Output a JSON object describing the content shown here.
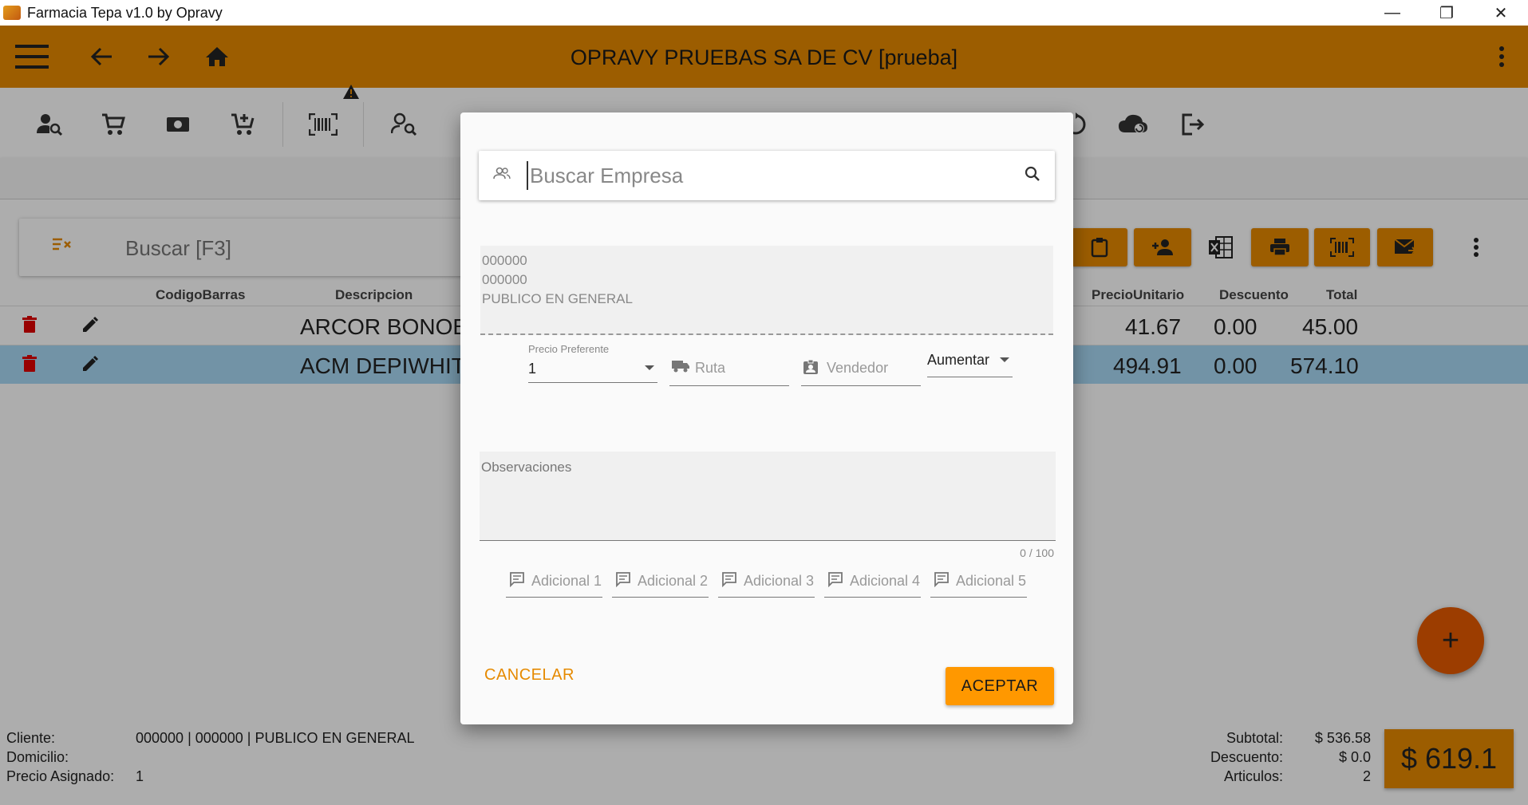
{
  "window": {
    "title": "Farmacia Tepa v1.0 by Opravy",
    "minimize": "—",
    "restore": "❐",
    "close": "✕"
  },
  "appbar": {
    "company": "OPRAVY PRUEBAS SA DE CV [prueba]",
    "color": "#e68a00"
  },
  "main": {
    "search_placeholder": "Buscar [F3]",
    "columns": {
      "codigo": "CodigoBarras",
      "descripcion": "Descripcion",
      "precio": "PrecioUnitario",
      "descuento": "Descuento",
      "total": "Total"
    },
    "rows": [
      {
        "descripcion": "ARCOR BONOB",
        "precio": "41.67",
        "descuento": "0.00",
        "total": "45.00",
        "selected": false
      },
      {
        "descripcion": "ACM DEPIWHIT",
        "precio": "494.91",
        "descuento": "0.00",
        "total": "574.10",
        "selected": true
      }
    ]
  },
  "footer": {
    "cliente_label": "Cliente:",
    "cliente_value": "000000 | 000000 | PUBLICO EN GENERAL",
    "domicilio_label": "Domicilio:",
    "precio_label": "Precio Asignado:",
    "precio_value": "1",
    "subtotal_label": "Subtotal:",
    "subtotal_value": "$ 536.58",
    "descuento_label": "Descuento:",
    "descuento_value": "$ 0.0",
    "articulos_label": "Articulos:",
    "articulos_value": "2",
    "total": "$ 619.1",
    "fab": "+"
  },
  "dialog": {
    "search_placeholder": "Buscar Empresa",
    "client_lines": [
      "000000",
      "000000",
      "PUBLICO EN GENERAL"
    ],
    "precio_label": "Precio Preferente",
    "precio_value": "1",
    "ruta_placeholder": "Ruta",
    "vendedor_placeholder": "Vendedor",
    "aumentar": "Aumentar",
    "observaciones_label": "Observaciones",
    "observaciones_count": "0 / 100",
    "adicionales": [
      "Adicional 1",
      "Adicional 2",
      "Adicional 3",
      "Adicional 4",
      "Adicional 5"
    ],
    "cancel": "CANCELAR",
    "accept": "ACEPTAR"
  }
}
